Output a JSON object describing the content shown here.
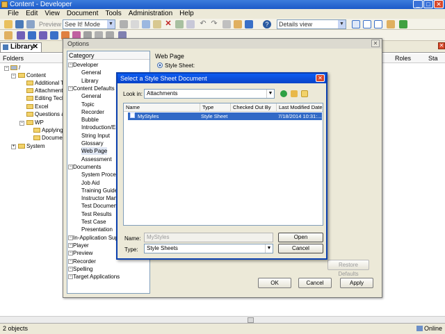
{
  "app": {
    "title": "Content - Developer",
    "status_left": "2 objects",
    "status_right": "Online"
  },
  "menubar": [
    "File",
    "Edit",
    "View",
    "Document",
    "Tools",
    "Administration",
    "Help"
  ],
  "toolbar": {
    "preview_label": "Preview",
    "mode_value": "See It! Mode",
    "view_value": "Details view"
  },
  "library": {
    "tab_label": "Library",
    "folders_header": "Folders",
    "roles_header": "Roles",
    "state_header": "Sta",
    "tree": [
      {
        "label": "/",
        "level": 0
      },
      {
        "label": "Content",
        "level": 1
      },
      {
        "label": "Additional Top",
        "level": 2
      },
      {
        "label": "Attachments",
        "level": 2
      },
      {
        "label": "Editing Techni",
        "level": 2
      },
      {
        "label": "Excel",
        "level": 2
      },
      {
        "label": "Questions and",
        "level": 2
      },
      {
        "label": "WP",
        "level": 2
      },
      {
        "label": "Applying F",
        "level": 3
      },
      {
        "label": "Documer",
        "level": 3
      },
      {
        "label": "System",
        "level": 1
      }
    ]
  },
  "options": {
    "title": "Options",
    "category_header": "Category",
    "categories": [
      {
        "label": "Developer",
        "level": 0,
        "selected": false
      },
      {
        "label": "General",
        "level": 1,
        "selected": false
      },
      {
        "label": "Library",
        "level": 1,
        "selected": false
      },
      {
        "label": "Content Defaults",
        "level": 0,
        "selected": false
      },
      {
        "label": "General",
        "level": 1,
        "selected": false
      },
      {
        "label": "Topic",
        "level": 1,
        "selected": false
      },
      {
        "label": "Recorder",
        "level": 1,
        "selected": false
      },
      {
        "label": "Bubble",
        "level": 1,
        "selected": false
      },
      {
        "label": "Introduction/En",
        "level": 1,
        "selected": false
      },
      {
        "label": "String Input",
        "level": 1,
        "selected": false
      },
      {
        "label": "Glossary",
        "level": 1,
        "selected": false
      },
      {
        "label": "Web Page",
        "level": 1,
        "selected": true
      },
      {
        "label": "Assessment",
        "level": 1,
        "selected": false
      },
      {
        "label": "Documents",
        "level": 0,
        "selected": false
      },
      {
        "label": "System Process",
        "level": 1,
        "selected": false
      },
      {
        "label": "Job Aid",
        "level": 1,
        "selected": false
      },
      {
        "label": "Training Guide",
        "level": 1,
        "selected": false
      },
      {
        "label": "Instructor Manu",
        "level": 1,
        "selected": false
      },
      {
        "label": "Test Document",
        "level": 1,
        "selected": false
      },
      {
        "label": "Test Results",
        "level": 1,
        "selected": false
      },
      {
        "label": "Test Case",
        "level": 1,
        "selected": false
      },
      {
        "label": "Presentation",
        "level": 1,
        "selected": false
      },
      {
        "label": "In-Application Supp",
        "level": 0,
        "selected": false
      },
      {
        "label": "Player",
        "level": 0,
        "selected": false
      },
      {
        "label": "Preview",
        "level": 0,
        "selected": false
      },
      {
        "label": "Recorder",
        "level": 0,
        "selected": false
      },
      {
        "label": "Spelling",
        "level": 0,
        "selected": false
      },
      {
        "label": "Target Applications",
        "level": 0,
        "selected": false
      }
    ],
    "section_title": "Web Page",
    "style_sheet_label": "Style Sheet:",
    "restore_defaults": "Restore Defaults",
    "ok": "OK",
    "cancel": "Cancel",
    "apply": "Apply"
  },
  "stylesheet_dialog": {
    "title": "Select a Style Sheet Document",
    "look_in_label": "Look in:",
    "look_in_value": "Attachments",
    "columns": [
      "Name",
      "Type",
      "Checked Out By",
      "Last Modified Date"
    ],
    "rows": [
      {
        "name": "MyStyles",
        "type": "Style Sheet",
        "checked_out_by": "",
        "modified": "7/18/2014 10:31:..."
      }
    ],
    "name_label": "Name:",
    "name_value": "MyStyles",
    "type_label": "Type:",
    "type_value": "Style Sheets",
    "open": "Open",
    "cancel": "Cancel"
  }
}
